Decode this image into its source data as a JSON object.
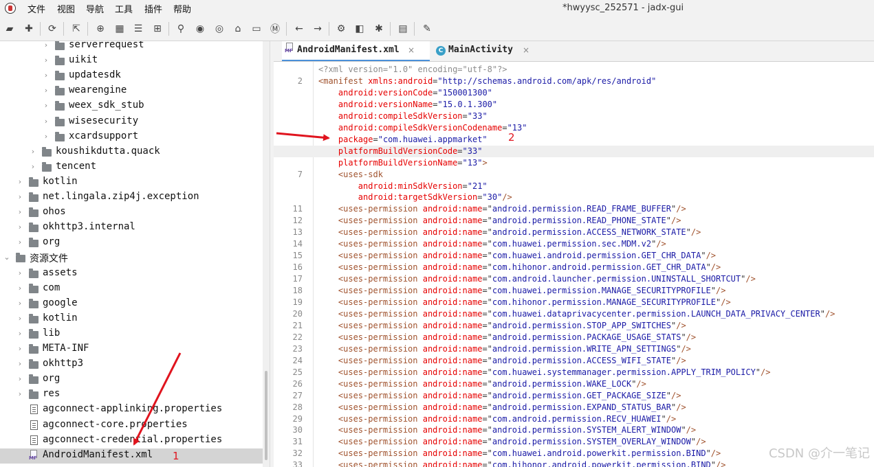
{
  "window": {
    "title": "*hwyysc_252571 - jadx-gui"
  },
  "menu": [
    "文件",
    "视图",
    "导航",
    "工具",
    "插件",
    "帮助"
  ],
  "toolbar_icons": [
    "open-icon",
    "add-files-icon",
    "sync-icon",
    "export-icon",
    "globe-icon",
    "package-icon",
    "class-icon",
    "tree-icon",
    "search-icon",
    "find-usage-icon",
    "find-icon",
    "home-icon",
    "window-icon",
    "m-icon",
    "back-icon",
    "forward-icon",
    "deobf-icon",
    "quark-icon",
    "debug-icon",
    "log-icon",
    "settings-wrench-icon"
  ],
  "tree": [
    {
      "label": "serverrequest",
      "type": "folder",
      "chevron": "›"
    },
    {
      "label": "uikit",
      "type": "folder",
      "chevron": "›"
    },
    {
      "label": "updatesdk",
      "type": "folder",
      "chevron": "›"
    },
    {
      "label": "wearengine",
      "type": "folder",
      "chevron": "›"
    },
    {
      "label": "weex_sdk_stub",
      "type": "folder",
      "chevron": "›"
    },
    {
      "label": "wisesecurity",
      "type": "folder",
      "chevron": "›"
    },
    {
      "label": "xcardsupport",
      "type": "folder",
      "chevron": "›"
    },
    {
      "label": "koushikdutta.quack",
      "type": "folder",
      "chevron": "›"
    },
    {
      "label": "tencent",
      "type": "folder",
      "chevron": "›"
    },
    {
      "label": "kotlin",
      "type": "folder",
      "chevron": "›"
    },
    {
      "label": "net.lingala.zip4j.exception",
      "type": "folder",
      "chevron": "›"
    },
    {
      "label": "ohos",
      "type": "folder",
      "chevron": "›"
    },
    {
      "label": "okhttp3.internal",
      "type": "folder",
      "chevron": "›"
    },
    {
      "label": "org",
      "type": "folder",
      "chevron": "›"
    },
    {
      "label": "资源文件",
      "type": "folder",
      "chevron": "⌄"
    },
    {
      "label": "assets",
      "type": "folder",
      "chevron": "›"
    },
    {
      "label": "com",
      "type": "folder",
      "chevron": "›"
    },
    {
      "label": "google",
      "type": "folder",
      "chevron": "›"
    },
    {
      "label": "kotlin",
      "type": "folder",
      "chevron": "›"
    },
    {
      "label": "lib",
      "type": "folder",
      "chevron": "›"
    },
    {
      "label": "META-INF",
      "type": "folder",
      "chevron": "›"
    },
    {
      "label": "okhttp3",
      "type": "folder",
      "chevron": "›"
    },
    {
      "label": "org",
      "type": "folder",
      "chevron": "›"
    },
    {
      "label": "res",
      "type": "folder",
      "chevron": "›"
    },
    {
      "label": "agconnect-applinking.properties",
      "type": "file",
      "chevron": ""
    },
    {
      "label": "agconnect-core.properties",
      "type": "file",
      "chevron": ""
    },
    {
      "label": "agconnect-credential.properties",
      "type": "file",
      "chevron": ""
    },
    {
      "label": "AndroidManifest.xml",
      "type": "manifest",
      "chevron": "",
      "selected": true
    }
  ],
  "tabs": [
    {
      "label": "AndroidManifest.xml",
      "icon_text": "MF",
      "active": true,
      "close": "×"
    },
    {
      "label": "MainActivity",
      "icon_text": "C",
      "active": false,
      "close": "×"
    }
  ],
  "code": [
    {
      "ln": "",
      "parts": [
        [
          "pi",
          "<?xml version=\"1.0\" encoding=\"utf-8\"?>"
        ]
      ]
    },
    {
      "ln": "2",
      "parts": [
        [
          "tag",
          "<manifest "
        ],
        [
          "attr",
          "xmlns:android"
        ],
        [
          "eq",
          "="
        ],
        [
          "val",
          "\"http://schemas.android.com/apk/res/android\""
        ]
      ]
    },
    {
      "ln": "",
      "parts": [
        [
          "sp",
          "    "
        ],
        [
          "attr",
          "android:versionCode"
        ],
        [
          "eq",
          "="
        ],
        [
          "val",
          "\"150001300\""
        ]
      ]
    },
    {
      "ln": "",
      "parts": [
        [
          "sp",
          "    "
        ],
        [
          "attr",
          "android:versionName"
        ],
        [
          "eq",
          "="
        ],
        [
          "val",
          "\"15.0.1.300\""
        ]
      ]
    },
    {
      "ln": "",
      "parts": [
        [
          "sp",
          "    "
        ],
        [
          "attr",
          "android:compileSdkVersion"
        ],
        [
          "eq",
          "="
        ],
        [
          "val",
          "\"33\""
        ]
      ]
    },
    {
      "ln": "",
      "parts": [
        [
          "sp",
          "    "
        ],
        [
          "attr",
          "android:compileSdkVersionCodename"
        ],
        [
          "eq",
          "="
        ],
        [
          "val",
          "\"13\""
        ]
      ]
    },
    {
      "ln": "",
      "parts": [
        [
          "sp",
          "    "
        ],
        [
          "attr",
          "package"
        ],
        [
          "eq",
          "="
        ],
        [
          "val",
          "\"com.huawei.appmarket\""
        ]
      ]
    },
    {
      "ln": "",
      "hl": true,
      "parts": [
        [
          "sp",
          "    "
        ],
        [
          "attr",
          "platformBuildVersionCode"
        ],
        [
          "eq",
          "="
        ],
        [
          "val",
          "\"33\""
        ]
      ]
    },
    {
      "ln": "",
      "parts": [
        [
          "sp",
          "    "
        ],
        [
          "attr",
          "platformBuildVersionName"
        ],
        [
          "eq",
          "="
        ],
        [
          "val",
          "\"13\""
        ],
        [
          "tag",
          ">"
        ]
      ]
    },
    {
      "ln": "7",
      "parts": [
        [
          "sp",
          "    "
        ],
        [
          "tag",
          "<uses-sdk"
        ]
      ]
    },
    {
      "ln": "",
      "parts": [
        [
          "sp",
          "        "
        ],
        [
          "attr",
          "android:minSdkVersion"
        ],
        [
          "eq",
          "="
        ],
        [
          "val",
          "\"21\""
        ]
      ]
    },
    {
      "ln": "",
      "parts": [
        [
          "sp",
          "        "
        ],
        [
          "attr",
          "android:targetSdkVersion"
        ],
        [
          "eq",
          "="
        ],
        [
          "val",
          "\"30\""
        ],
        [
          "tag",
          "/>"
        ]
      ]
    },
    {
      "ln": "11",
      "perm": "android.permission.READ_FRAME_BUFFER"
    },
    {
      "ln": "12",
      "perm": "android.permission.READ_PHONE_STATE"
    },
    {
      "ln": "13",
      "perm": "android.permission.ACCESS_NETWORK_STATE"
    },
    {
      "ln": "14",
      "perm": "com.huawei.permission.sec.MDM.v2"
    },
    {
      "ln": "15",
      "perm": "com.huawei.android.permission.GET_CHR_DATA"
    },
    {
      "ln": "16",
      "perm": "com.hihonor.android.permission.GET_CHR_DATA"
    },
    {
      "ln": "17",
      "perm": "com.android.launcher.permission.UNINSTALL_SHORTCUT"
    },
    {
      "ln": "18",
      "perm": "com.huawei.permission.MANAGE_SECURITYPROFILE"
    },
    {
      "ln": "19",
      "perm": "com.hihonor.permission.MANAGE_SECURITYPROFILE"
    },
    {
      "ln": "20",
      "perm": "com.huawei.dataprivacycenter.permission.LAUNCH_DATA_PRIVACY_CENTER"
    },
    {
      "ln": "21",
      "perm": "android.permission.STOP_APP_SWITCHES"
    },
    {
      "ln": "22",
      "perm": "android.permission.PACKAGE_USAGE_STATS"
    },
    {
      "ln": "23",
      "perm": "android.permission.WRITE_APN_SETTINGS"
    },
    {
      "ln": "24",
      "perm": "android.permission.ACCESS_WIFI_STATE"
    },
    {
      "ln": "25",
      "perm": "com.huawei.systemmanager.permission.APPLY_TRIM_POLICY"
    },
    {
      "ln": "26",
      "perm": "android.permission.WAKE_LOCK"
    },
    {
      "ln": "27",
      "perm": "android.permission.GET_PACKAGE_SIZE"
    },
    {
      "ln": "28",
      "perm": "android.permission.EXPAND_STATUS_BAR"
    },
    {
      "ln": "29",
      "perm": "com.android.permission.RECV_HUAWEI"
    },
    {
      "ln": "30",
      "perm": "android.permission.SYSTEM_ALERT_WINDOW"
    },
    {
      "ln": "31",
      "perm": "android.permission.SYSTEM_OVERLAY_WINDOW"
    },
    {
      "ln": "32",
      "perm": "com.huawei.android.powerkit.permission.BIND"
    },
    {
      "ln": "33",
      "perm": "com.hihonor.android.powerkit.permission.BIND"
    }
  ],
  "perm_tag": "<uses-permission ",
  "perm_attr": "android:name",
  "perm_close": "/>",
  "annotations": {
    "package_marker": "2",
    "manifest_marker": "1"
  },
  "watermark": "CSDN @介一笔记",
  "colors": {
    "arrow": "#e0141e",
    "selection": "#d4d4d4",
    "attr": "#e60000",
    "value": "#1a1aa6",
    "tag": "#a0522d"
  }
}
